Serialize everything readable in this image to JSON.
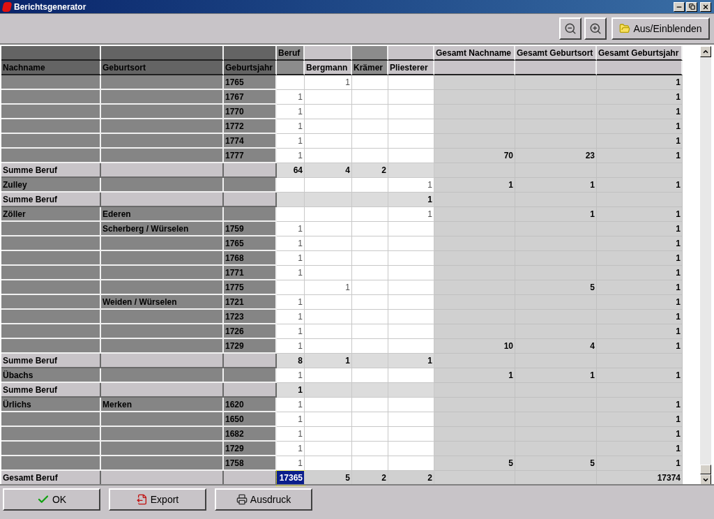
{
  "window": {
    "title": "Berichtsgenerator"
  },
  "toolbar": {
    "buttons": [
      {
        "kind": "zoom_out"
      },
      {
        "kind": "zoom_in"
      },
      {
        "kind": "toggle",
        "label": "Aus/Einblenden"
      }
    ]
  },
  "table": {
    "columns": [
      {
        "bottom": "Nachname"
      },
      {
        "bottom": "Geburtsort"
      },
      {
        "bottom": "Geburtsjahr"
      },
      {
        "top": "Beruf"
      },
      {
        "bottom": "Bergmann"
      },
      {
        "bottom": "Krämer"
      },
      {
        "bottom": "Pliesterer"
      },
      {
        "top": "Gesamt Nachname"
      },
      {
        "top": "Gesamt Geburtsort"
      },
      {
        "top": "Gesamt Geburtsjahr"
      }
    ],
    "rows": [
      {
        "kind": "data",
        "selected": false,
        "year": "1765",
        "bergmann": "1",
        "total_year": "1"
      },
      {
        "kind": "data",
        "selected": false,
        "year": "1767",
        "beruf": "1",
        "total_year": "1"
      },
      {
        "kind": "data",
        "selected": false,
        "year": "1770",
        "beruf": "1",
        "total_year": "1"
      },
      {
        "kind": "data",
        "selected": false,
        "year": "1772",
        "beruf": "1",
        "total_year": "1"
      },
      {
        "kind": "data",
        "selected": false,
        "year": "1774",
        "beruf": "1",
        "total_year": "1"
      },
      {
        "kind": "data",
        "selected": false,
        "year": "1777",
        "beruf": "1",
        "total_name": "70",
        "total_place": "23",
        "total_year": "1"
      },
      {
        "kind": "sum",
        "selected": false,
        "name": "Summe Beruf",
        "beruf": "64",
        "bergmann": "4",
        "kraemer": "2"
      },
      {
        "kind": "data",
        "selected": false,
        "name": "Zulley",
        "pliesterer": "1",
        "total_name": "1",
        "total_place": "1",
        "total_year": "1"
      },
      {
        "kind": "sum",
        "selected": false,
        "name": "Summe Beruf",
        "pliesterer": "1"
      },
      {
        "kind": "data",
        "selected": false,
        "name": "Zöller",
        "place": "Ederen",
        "pliesterer": "1",
        "total_place": "1",
        "total_year": "1"
      },
      {
        "kind": "data",
        "selected": false,
        "place": "Scherberg / Würselen",
        "year": "1759",
        "beruf": "1",
        "total_year": "1"
      },
      {
        "kind": "data",
        "selected": false,
        "year": "1765",
        "beruf": "1",
        "total_year": "1"
      },
      {
        "kind": "data",
        "selected": false,
        "year": "1768",
        "beruf": "1",
        "total_year": "1"
      },
      {
        "kind": "data",
        "selected": false,
        "year": "1771",
        "beruf": "1",
        "total_year": "1"
      },
      {
        "kind": "data",
        "selected": false,
        "year": "1775",
        "bergmann": "1",
        "total_place": "5",
        "total_year": "1"
      },
      {
        "kind": "data",
        "selected": false,
        "place": "Weiden / Würselen",
        "year": "1721",
        "beruf": "1",
        "total_year": "1"
      },
      {
        "kind": "data",
        "selected": false,
        "year": "1723",
        "beruf": "1",
        "total_year": "1"
      },
      {
        "kind": "data",
        "selected": false,
        "year": "1726",
        "beruf": "1",
        "total_year": "1"
      },
      {
        "kind": "data",
        "selected": false,
        "year": "1729",
        "beruf": "1",
        "total_name": "10",
        "total_place": "4",
        "total_year": "1"
      },
      {
        "kind": "sum",
        "selected": false,
        "name": "Summe Beruf",
        "beruf": "8",
        "bergmann": "1",
        "pliesterer": "1"
      },
      {
        "kind": "data",
        "selected": false,
        "name": "Übachs",
        "beruf": "1",
        "total_name": "1",
        "total_place": "1",
        "total_year": "1"
      },
      {
        "kind": "sum",
        "selected": false,
        "name": "Summe Beruf",
        "beruf": "1"
      },
      {
        "kind": "data",
        "selected": false,
        "name": "Ürlichs",
        "place": "Merken",
        "year": "1620",
        "beruf": "1",
        "total_year": "1"
      },
      {
        "kind": "data",
        "selected": false,
        "year": "1650",
        "beruf": "1",
        "total_year": "1"
      },
      {
        "kind": "data",
        "selected": false,
        "year": "1682",
        "beruf": "1",
        "total_year": "1"
      },
      {
        "kind": "data",
        "selected": false,
        "year": "1729",
        "beruf": "1",
        "total_year": "1"
      },
      {
        "kind": "data",
        "selected": false,
        "year": "1758",
        "beruf": "1",
        "total_name": "5",
        "total_place": "5",
        "total_year": "1"
      },
      {
        "kind": "total",
        "selected": true,
        "name": "Gesamt Beruf",
        "beruf": "17365",
        "bergmann": "5",
        "kraemer": "2",
        "pliesterer": "2",
        "total_year": "17374"
      }
    ]
  },
  "footer": {
    "buttons": [
      {
        "kind": "ok",
        "label": "OK"
      },
      {
        "kind": "export",
        "label": "Export"
      },
      {
        "kind": "print",
        "label": "Ausdruck"
      }
    ]
  }
}
